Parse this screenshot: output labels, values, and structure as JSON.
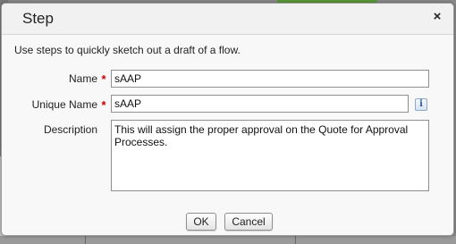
{
  "dialog": {
    "title": "Step",
    "close_glyph": "×",
    "close_icon": "close-icon",
    "intro": "Use steps to quickly sketch out a draft of a flow."
  },
  "form": {
    "required_marker": "*",
    "name": {
      "label": "Name",
      "value": "sAAP"
    },
    "unique_name": {
      "label": "Unique Name",
      "value": "sAAP",
      "info_glyph": "i",
      "info_icon": "info-icon"
    },
    "description": {
      "label": "Description",
      "value": "This will assign the proper approval on the Quote for Approval Processes."
    }
  },
  "buttons": {
    "ok": "OK",
    "cancel": "Cancel"
  },
  "colors": {
    "required": "#cc0000",
    "backdrop": "#8a8a8a",
    "dialog_bg": "#f8f8f8",
    "info_icon": "#2e5c99"
  }
}
